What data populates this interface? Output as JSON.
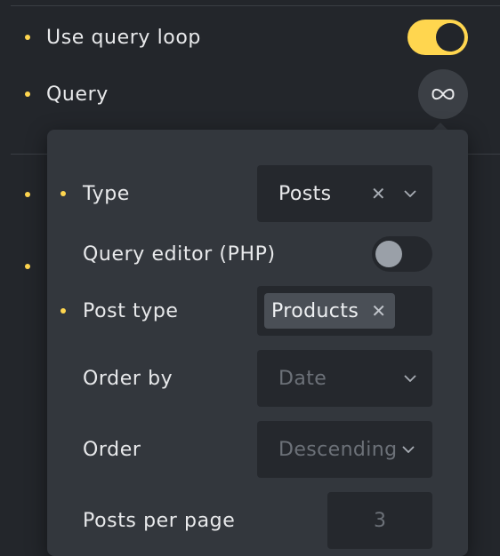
{
  "outer": {
    "use_query_loop_label": "Use query loop",
    "use_query_loop_on": true,
    "query_label": "Query",
    "query_icon": "infinity-icon"
  },
  "popover": {
    "type": {
      "label": "Type",
      "value": "Posts"
    },
    "query_editor": {
      "label": "Query editor (PHP)",
      "on": false
    },
    "post_type": {
      "label": "Post type",
      "chips": [
        "Products"
      ]
    },
    "order_by": {
      "label": "Order by",
      "placeholder": "Date"
    },
    "order": {
      "label": "Order",
      "placeholder": "Descending"
    },
    "posts_per_page": {
      "label": "Posts per page",
      "placeholder": "3"
    }
  },
  "colors": {
    "accent": "#ffd64f",
    "panel_bg": "#23262b",
    "popover_bg": "#33373d",
    "control_bg": "#25282d"
  }
}
